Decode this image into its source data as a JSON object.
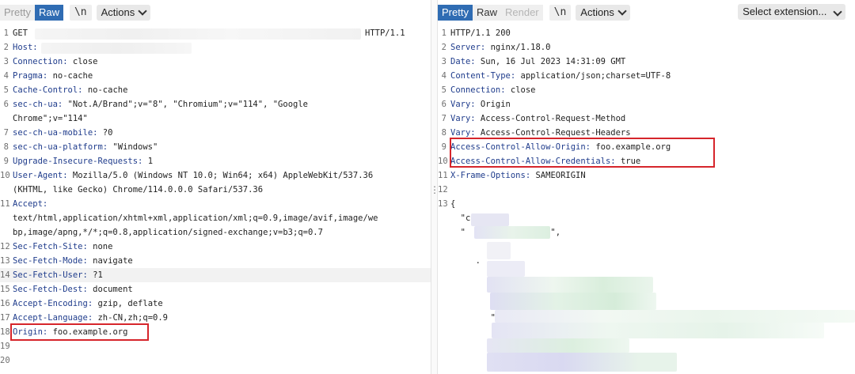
{
  "request": {
    "tabs": [
      "Pretty",
      "Raw"
    ],
    "active_tab": "Raw",
    "newline_button": "\\n",
    "actions_label": "Actions",
    "lines": [
      {
        "n": "1",
        "text": "GET",
        "tail": "HTTP/1.1"
      },
      {
        "n": "2",
        "key": "Host:"
      },
      {
        "n": "3",
        "key": "Connection:",
        "value": " close"
      },
      {
        "n": "4",
        "key": "Pragma:",
        "value": " no-cache"
      },
      {
        "n": "5",
        "key": "Cache-Control:",
        "value": " no-cache"
      },
      {
        "n": "6",
        "key": "sec-ch-ua:",
        "value": " \"Not.A/Brand\";v=\"8\", \"Chromium\";v=\"114\", \"Google"
      },
      {
        "n": "",
        "text": "Chrome\";v=\"114\""
      },
      {
        "n": "7",
        "key": "sec-ch-ua-mobile:",
        "value": " ?0"
      },
      {
        "n": "8",
        "key": "sec-ch-ua-platform:",
        "value": " \"Windows\""
      },
      {
        "n": "9",
        "key": "Upgrade-Insecure-Requests:",
        "value": " 1"
      },
      {
        "n": "10",
        "key": "User-Agent:",
        "value": " Mozilla/5.0 (Windows NT 10.0; Win64; x64) AppleWebKit/537.36"
      },
      {
        "n": "",
        "text": "(KHTML, like Gecko) Chrome/114.0.0.0 Safari/537.36"
      },
      {
        "n": "11",
        "key": "Accept:"
      },
      {
        "n": "",
        "text": "text/html,application/xhtml+xml,application/xml;q=0.9,image/avif,image/we"
      },
      {
        "n": "",
        "text": "bp,image/apng,*/*;q=0.8,application/signed-exchange;v=b3;q=0.7"
      },
      {
        "n": "12",
        "key": "Sec-Fetch-Site:",
        "value": " none"
      },
      {
        "n": "13",
        "key": "Sec-Fetch-Mode:",
        "value": " navigate"
      },
      {
        "n": "14",
        "key": "Sec-Fetch-User:",
        "value": " ?1",
        "hl": true
      },
      {
        "n": "15",
        "key": "Sec-Fetch-Dest:",
        "value": " document"
      },
      {
        "n": "16",
        "key": "Accept-Encoding:",
        "value": " gzip, deflate"
      },
      {
        "n": "17",
        "key": "Accept-Language:",
        "value": " zh-CN,zh;q=0.9"
      },
      {
        "n": "18",
        "key": "Origin:",
        "value": " foo.example.org"
      },
      {
        "n": "19"
      },
      {
        "n": "20"
      }
    ]
  },
  "response": {
    "tabs": [
      "Pretty",
      "Raw",
      "Render"
    ],
    "active_tab": "Pretty",
    "newline_button": "\\n",
    "actions_label": "Actions",
    "select_extension_label": "Select extension...",
    "lines": [
      {
        "n": "1",
        "text": "HTTP/1.1 200"
      },
      {
        "n": "2",
        "key": "Server:",
        "value": " nginx/1.18.0"
      },
      {
        "n": "3",
        "key": "Date:",
        "value": " Sun, 16 Jul 2023 14:31:09 GMT"
      },
      {
        "n": "4",
        "key": "Content-Type:",
        "value": " application/json;charset=UTF-8"
      },
      {
        "n": "5",
        "key": "Connection:",
        "value": " close"
      },
      {
        "n": "6",
        "key": "Vary:",
        "value": " Origin"
      },
      {
        "n": "7",
        "key": "Vary:",
        "value": " Access-Control-Request-Method"
      },
      {
        "n": "8",
        "key": "Vary:",
        "value": " Access-Control-Request-Headers"
      },
      {
        "n": "9",
        "key": "Access-Control-Allow-Origin:",
        "value": " foo.example.org"
      },
      {
        "n": "10",
        "key": "Access-Control-Allow-Credentials:",
        "value": " true"
      },
      {
        "n": "11",
        "key": "X-Frame-Options:",
        "value": " SAMEORIGIN"
      },
      {
        "n": "12"
      },
      {
        "n": "13",
        "text": "{"
      },
      {
        "n": "",
        "text": "  \"c"
      },
      {
        "n": "",
        "text": "  \"                 \","
      },
      {
        "n": ""
      },
      {
        "n": "",
        "text": "     ."
      },
      {
        "n": ""
      },
      {
        "n": ""
      },
      {
        "n": "",
        "text": "                                \","
      },
      {
        "n": "",
        "text": "        \"d"
      },
      {
        "n": "",
        "text": "        \"r"
      }
    ]
  },
  "colors": {
    "accent": "#2f6cb3",
    "header_key": "#1f3c8c",
    "highlight_box": "#d6252b",
    "redaction_green": "#d8eedb",
    "redaction_purple": "#dcdcf2"
  }
}
